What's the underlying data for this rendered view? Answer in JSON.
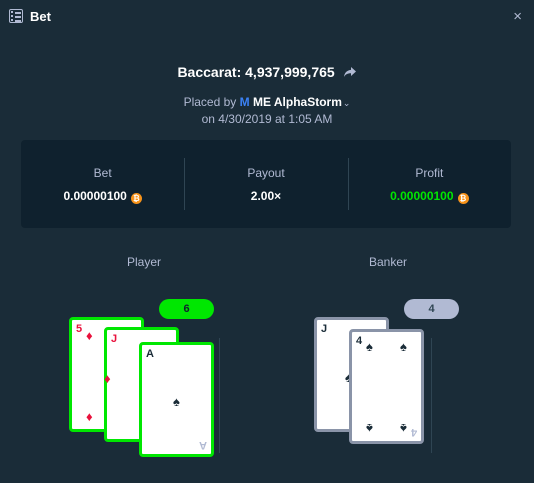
{
  "window": {
    "title": "Bet",
    "close": "×"
  },
  "game": {
    "label": "Baccarat: 4,937,999,765"
  },
  "placed": {
    "prefix": "Placed by",
    "badge": "M",
    "user": "ME AlphaStorm",
    "chevron": "⌄",
    "date": "on 4/30/2019 at 1:05 AM"
  },
  "stats": {
    "bet": {
      "label": "Bet",
      "value": "0.00000100"
    },
    "payout": {
      "label": "Payout",
      "value": "2.00×"
    },
    "profit": {
      "label": "Profit",
      "value": "0.00000100"
    }
  },
  "coin": "₿",
  "player": {
    "label": "Player",
    "score": "6",
    "cards": [
      {
        "rank": "5",
        "suit": "♦",
        "color": "red"
      },
      {
        "rank": "J",
        "suit": "♦",
        "color": "red"
      },
      {
        "rank": "A",
        "suit": "♠",
        "color": "black"
      }
    ]
  },
  "banker": {
    "label": "Banker",
    "score": "4",
    "cards": [
      {
        "rank": "J",
        "suit": "♠",
        "color": "black"
      },
      {
        "rank": "4",
        "suit": "♠",
        "color": "black"
      }
    ]
  },
  "colors": {
    "background": "#1a2c38",
    "panel": "#0f212e",
    "win": "#00e701",
    "muted": "#b1bad3",
    "bitcoin": "#f7931a"
  }
}
